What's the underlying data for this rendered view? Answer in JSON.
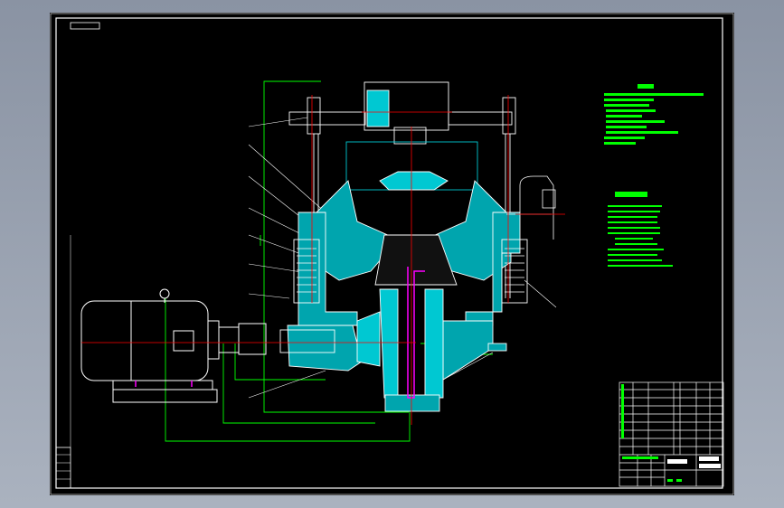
{
  "colors": {
    "background": "#000000",
    "outline": "#ffffff",
    "section_fill": "#00c8d2",
    "centerline": "#ff0000",
    "dimension": "#00ff00",
    "shaft_highlight": "#ff00ff",
    "viewport_border": "#9aa3b2"
  },
  "drawing": {
    "type": "cone crusher assembly drawing",
    "views": [
      "motor-drive",
      "crusher-section"
    ],
    "technical_notes_lines": 11,
    "parameter_lines": 12
  }
}
